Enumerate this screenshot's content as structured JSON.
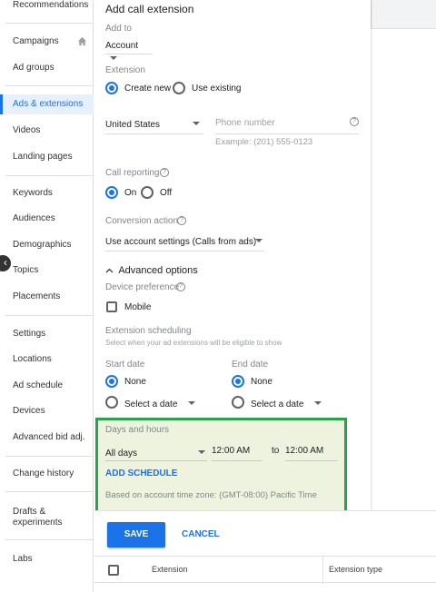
{
  "sidebar": {
    "items": [
      {
        "label": "Recommendations"
      },
      {
        "label": "Campaigns"
      },
      {
        "label": "Ad groups"
      },
      {
        "label": "Ads & extensions"
      },
      {
        "label": "Videos"
      },
      {
        "label": "Landing pages"
      },
      {
        "label": "Keywords"
      },
      {
        "label": "Audiences"
      },
      {
        "label": "Demographics"
      },
      {
        "label": "Topics"
      },
      {
        "label": "Placements"
      },
      {
        "label": "Settings"
      },
      {
        "label": "Locations"
      },
      {
        "label": "Ad schedule"
      },
      {
        "label": "Devices"
      },
      {
        "label": "Advanced bid adj."
      },
      {
        "label": "Change history"
      },
      {
        "label": "Drafts &"
      },
      {
        "label": "experiments"
      },
      {
        "label": "Labs"
      }
    ],
    "collapse_glyph": "‹"
  },
  "form": {
    "title": "Add call extension",
    "add_to": {
      "label": "Add to",
      "value": "Account"
    },
    "extension": {
      "label": "Extension",
      "option_new": "Create new",
      "option_existing": "Use existing"
    },
    "country": "United States",
    "phone": {
      "placeholder": "Phone number",
      "hint": "Example: (201) 555-0123"
    },
    "call_reporting": {
      "label": "Call reporting",
      "on": "On",
      "off": "Off"
    },
    "conversion": {
      "label": "Conversion action",
      "value": "Use account settings (Calls from ads)"
    },
    "advanced": {
      "label": "Advanced options"
    },
    "device": {
      "label": "Device preference",
      "mobile": "Mobile"
    },
    "scheduling": {
      "label": "Extension scheduling",
      "hint": "Select when your ad extensions will be eligible to show"
    },
    "start_date": {
      "label": "Start date",
      "none": "None",
      "select": "Select a date"
    },
    "end_date": {
      "label": "End date",
      "none": "None",
      "select": "Select a date"
    },
    "days_hours": {
      "label": "Days and hours",
      "day_value": "All days",
      "from": "12:00 AM",
      "to_label": "to",
      "to": "12:00 AM",
      "add_schedule": "ADD SCHEDULE",
      "timezone": "Based on account time zone: (GMT-08:00) Pacific Time"
    },
    "help_glyph": "?"
  },
  "actions": {
    "save": "SAVE",
    "cancel": "CANCEL"
  },
  "table": {
    "col_extension": "Extension",
    "col_type": "Extension type"
  },
  "colors": {
    "accent": "#1a73e8",
    "highlight_border": "#2aa24b"
  }
}
